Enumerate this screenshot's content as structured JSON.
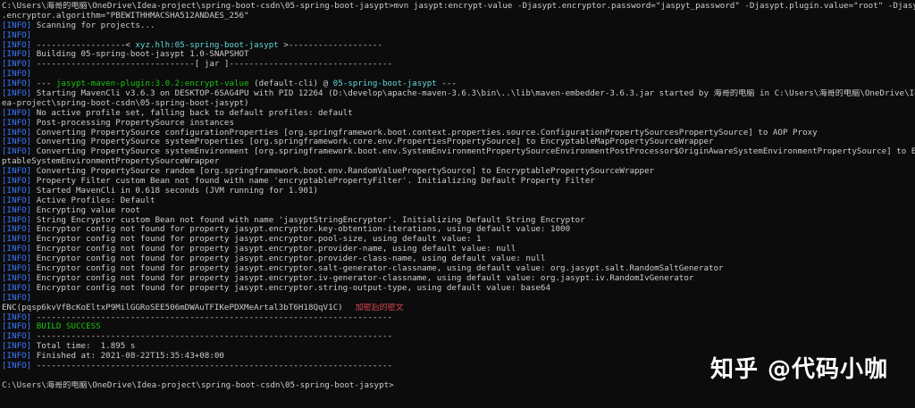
{
  "lines": [
    {
      "segs": [
        {
          "t": "C:\\Users\\海哥的电脑\\OneDrive\\Idea-project\\spring-boot-csdn\\05-spring-boot-jasypt>mvn jasypt:encrypt-value -Djasypt.encryptor.password=\"jaspyt_password\" -Djasypt.plugin.value=\"root\" -Djasypt"
        }
      ]
    },
    {
      "segs": [
        {
          "t": ".encryptor.algorithm=\"PBEWITHHMACSHA512ANDAES_256\""
        }
      ]
    },
    {
      "segs": [
        {
          "t": "[INFO]",
          "c": "pfx"
        },
        {
          "t": " Scanning for projects..."
        }
      ]
    },
    {
      "segs": [
        {
          "t": "[INFO]",
          "c": "pfx"
        }
      ]
    },
    {
      "segs": [
        {
          "t": "[INFO]",
          "c": "pfx"
        },
        {
          "t": " ------------------< "
        },
        {
          "t": "xyz.hlh:05-spring-boot-jasypt",
          "c": "cyn"
        },
        {
          "t": " >-------------------"
        }
      ]
    },
    {
      "segs": [
        {
          "t": "[INFO]",
          "c": "pfx"
        },
        {
          "t": " Building 05-spring-boot-jasypt 1.0-SNAPSHOT"
        }
      ]
    },
    {
      "segs": [
        {
          "t": "[INFO]",
          "c": "pfx"
        },
        {
          "t": " --------------------------------[ jar ]---------------------------------"
        }
      ]
    },
    {
      "segs": [
        {
          "t": "[INFO]",
          "c": "pfx"
        }
      ]
    },
    {
      "segs": [
        {
          "t": "[INFO]",
          "c": "pfx"
        },
        {
          "t": " --- "
        },
        {
          "t": "jasypt-maven-plugin:3.0.2:encrypt-value",
          "c": "grn"
        },
        {
          "t": " (default-cli) @ "
        },
        {
          "t": "05-spring-boot-jasypt",
          "c": "cyn"
        },
        {
          "t": " ---"
        }
      ]
    },
    {
      "segs": [
        {
          "t": "[INFO]",
          "c": "pfx"
        },
        {
          "t": " Starting MavenCli v3.6.3 on DESKTOP-6SAG4PU with PID 12264 (D:\\develop\\apache-maven-3.6.3\\bin\\..\\lib\\maven-embedder-3.6.3.jar started by 海哥的电脑 in C:\\Users\\海哥的电脑\\OneDrive\\Id"
        }
      ]
    },
    {
      "segs": [
        {
          "t": "ea-project\\spring-boot-csdn\\05-spring-boot-jasypt)"
        }
      ]
    },
    {
      "segs": [
        {
          "t": "[INFO]",
          "c": "pfx"
        },
        {
          "t": " No active profile set, falling back to default profiles: default"
        }
      ]
    },
    {
      "segs": [
        {
          "t": "[INFO]",
          "c": "pfx"
        },
        {
          "t": " Post-processing PropertySource instances"
        }
      ]
    },
    {
      "segs": [
        {
          "t": "[INFO]",
          "c": "pfx"
        },
        {
          "t": " Converting PropertySource configurationProperties [org.springframework.boot.context.properties.source.ConfigurationPropertySourcesPropertySource] to AOP Proxy"
        }
      ]
    },
    {
      "segs": [
        {
          "t": "[INFO]",
          "c": "pfx"
        },
        {
          "t": " Converting PropertySource systemProperties [org.springframework.core.env.PropertiesPropertySource] to EncryptableMapPropertySourceWrapper"
        }
      ]
    },
    {
      "segs": [
        {
          "t": "[INFO]",
          "c": "pfx"
        },
        {
          "t": " Converting PropertySource systemEnvironment [org.springframework.boot.env.SystemEnvironmentPropertySourceEnvironmentPostProcessor$OriginAwareSystemEnvironmentPropertySource] to Encry"
        }
      ]
    },
    {
      "segs": [
        {
          "t": "ptableSystemEnvironmentPropertySourceWrapper"
        }
      ]
    },
    {
      "segs": [
        {
          "t": "[INFO]",
          "c": "pfx"
        },
        {
          "t": " Converting PropertySource random [org.springframework.boot.env.RandomValuePropertySource] to EncryptablePropertySourceWrapper"
        }
      ]
    },
    {
      "segs": [
        {
          "t": "[INFO]",
          "c": "pfx"
        },
        {
          "t": " Property Filter custom Bean not found with name 'encryptablePropertyFilter'. Initializing Default Property Filter"
        }
      ]
    },
    {
      "segs": [
        {
          "t": "[INFO]",
          "c": "pfx"
        },
        {
          "t": " Started MavenCli in 0.618 seconds (JVM running for 1.901)"
        }
      ]
    },
    {
      "segs": [
        {
          "t": "[INFO]",
          "c": "pfx"
        },
        {
          "t": " Active Profiles: Default"
        }
      ]
    },
    {
      "segs": [
        {
          "t": "[INFO]",
          "c": "pfx"
        },
        {
          "t": " Encrypting value root"
        }
      ]
    },
    {
      "segs": [
        {
          "t": "[INFO]",
          "c": "pfx"
        },
        {
          "t": " String Encryptor custom Bean not found with name 'jasyptStringEncryptor'. Initializing Default String Encryptor"
        }
      ]
    },
    {
      "segs": [
        {
          "t": "[INFO]",
          "c": "pfx"
        },
        {
          "t": " Encryptor config not found for property jasypt.encryptor.key-obtention-iterations, using default value: 1000"
        }
      ]
    },
    {
      "segs": [
        {
          "t": "[INFO]",
          "c": "pfx"
        },
        {
          "t": " Encryptor config not found for property jasypt.encryptor.pool-size, using default value: 1"
        }
      ]
    },
    {
      "segs": [
        {
          "t": "[INFO]",
          "c": "pfx"
        },
        {
          "t": " Encryptor config not found for property jasypt.encryptor.provider-name, using default value: null"
        }
      ]
    },
    {
      "segs": [
        {
          "t": "[INFO]",
          "c": "pfx"
        },
        {
          "t": " Encryptor config not found for property jasypt.encryptor.provider-class-name, using default value: null"
        }
      ]
    },
    {
      "segs": [
        {
          "t": "[INFO]",
          "c": "pfx"
        },
        {
          "t": " Encryptor config not found for property jasypt.encryptor.salt-generator-classname, using default value: org.jasypt.salt.RandomSaltGenerator"
        }
      ]
    },
    {
      "segs": [
        {
          "t": "[INFO]",
          "c": "pfx"
        },
        {
          "t": " Encryptor config not found for property jasypt.encryptor.iv-generator-classname, using default value: org.jasypt.iv.RandomIvGenerator"
        }
      ]
    },
    {
      "segs": [
        {
          "t": "[INFO]",
          "c": "pfx"
        },
        {
          "t": " Encryptor config not found for property jasypt.encryptor.string-output-type, using default value: base64"
        }
      ]
    },
    {
      "segs": [
        {
          "t": "[INFO]",
          "c": "pfx"
        }
      ]
    },
    {
      "segs": [
        {
          "t": "ENC(pqsp6kvVfBcKoEltxP9MilGGRoSEE506mDWAuTFIKePDXMeArtal3bT6H18QqV1C)"
        },
        {
          "t": "加密后的密文",
          "c": "anno"
        }
      ]
    },
    {
      "segs": [
        {
          "t": "[INFO]",
          "c": "pfx"
        },
        {
          "t": " ------------------------------------------------------------------------"
        }
      ]
    },
    {
      "segs": [
        {
          "t": "[INFO]",
          "c": "pfx"
        },
        {
          "t": " "
        },
        {
          "t": "BUILD SUCCESS",
          "c": "grn"
        }
      ]
    },
    {
      "segs": [
        {
          "t": "[INFO]",
          "c": "pfx"
        },
        {
          "t": " ------------------------------------------------------------------------"
        }
      ]
    },
    {
      "segs": [
        {
          "t": "[INFO]",
          "c": "pfx"
        },
        {
          "t": " Total time:  1.895 s"
        }
      ]
    },
    {
      "segs": [
        {
          "t": "[INFO]",
          "c": "pfx"
        },
        {
          "t": " Finished at: 2021-08-22T15:35:43+08:00"
        }
      ]
    },
    {
      "segs": [
        {
          "t": "[INFO]",
          "c": "pfx"
        },
        {
          "t": " ------------------------------------------------------------------------"
        }
      ]
    },
    {
      "segs": []
    },
    {
      "segs": [
        {
          "t": "C:\\Users\\海哥的电脑\\OneDrive\\Idea-project\\spring-boot-csdn\\05-spring-boot-jasypt>"
        }
      ]
    }
  ],
  "watermark": "知乎 @代码小咖"
}
